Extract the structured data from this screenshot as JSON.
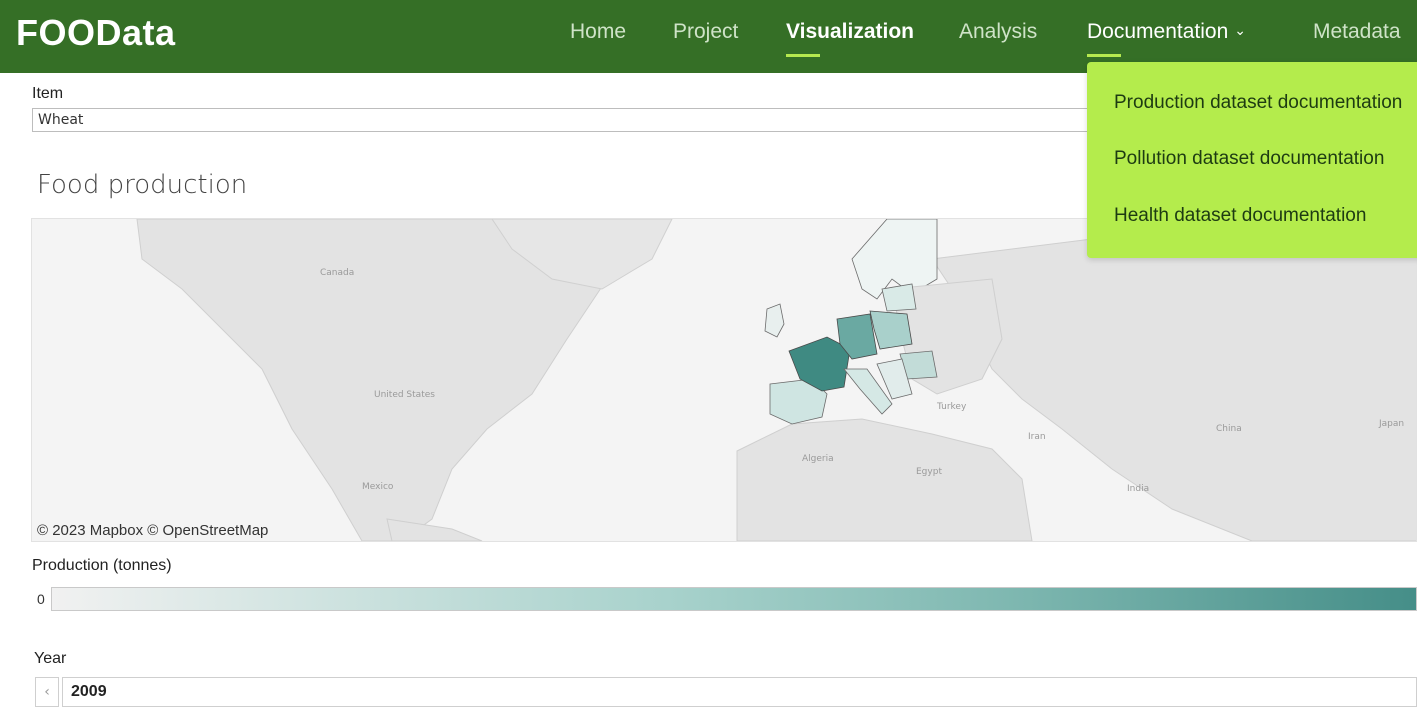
{
  "app": {
    "logo": "FOOData"
  },
  "nav": {
    "home": "Home",
    "project": "Project",
    "visualization": "Visualization",
    "analysis": "Analysis",
    "documentation": "Documentation",
    "metadata": "Metadata",
    "active": "Visualization"
  },
  "documentation_menu": {
    "items": [
      "Production dataset documentation",
      "Pollution dataset documentation",
      "Health dataset documentation"
    ]
  },
  "item_filter": {
    "label": "Item",
    "value": "Wheat"
  },
  "chart": {
    "title": "Food production"
  },
  "map": {
    "labels": [
      "Canada",
      "United States",
      "Mexico",
      "Algeria",
      "Egypt",
      "Turkey",
      "Iran",
      "India",
      "China",
      "Japan"
    ],
    "attribution": "© 2023 Mapbox © OpenStreetMap",
    "highlight_colors": [
      "#3f8a82",
      "#6aa9a2",
      "#a9d0cb",
      "#d5e8e5"
    ]
  },
  "legend": {
    "title": "Production (tonnes)",
    "min": "0"
  },
  "year_filter": {
    "label": "Year",
    "value": "2009",
    "prev_icon": "chevron-left-icon"
  },
  "colors": {
    "nav_bg": "#356f26",
    "accent": "#b4ec4c",
    "map_high": "#3f8a82"
  }
}
